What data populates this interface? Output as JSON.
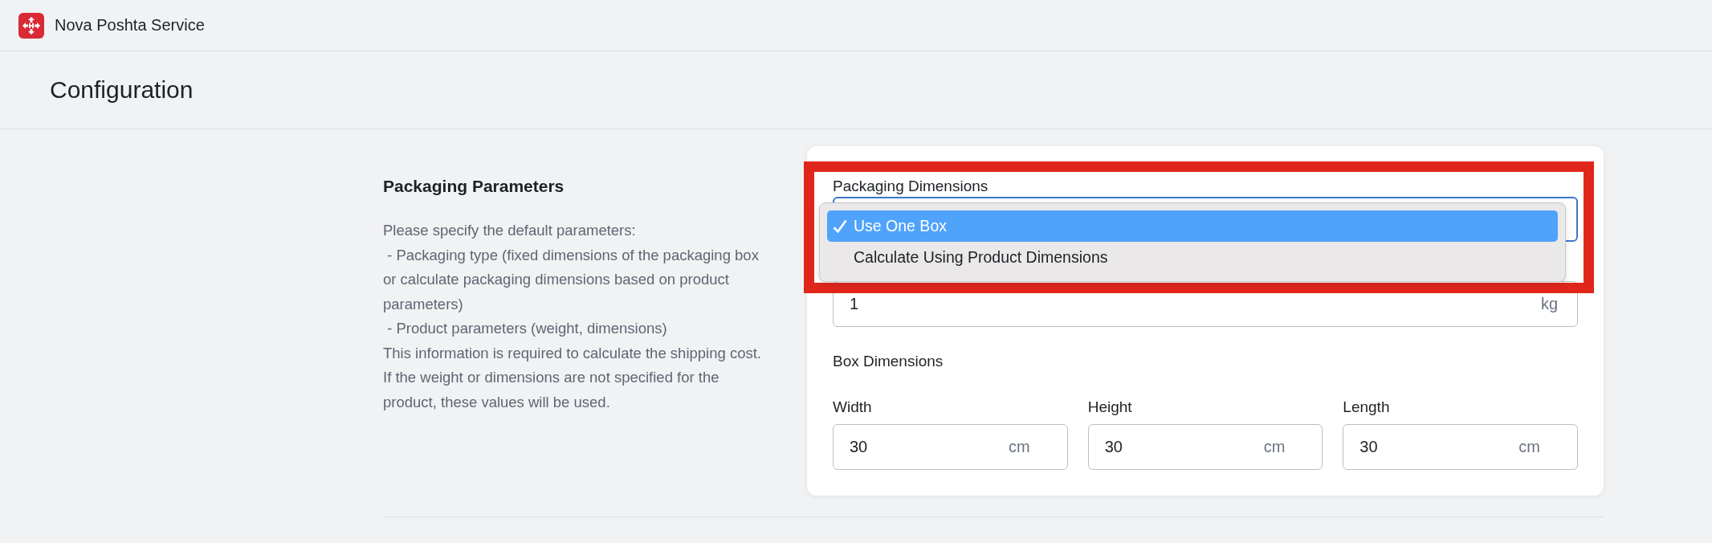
{
  "app": {
    "title": "Nova Poshta Service"
  },
  "page": {
    "title": "Configuration"
  },
  "section": {
    "title": "Packaging Parameters",
    "description": "Please specify the default parameters:\n - Packaging type (fixed dimensions of the packaging box or calculate packaging dimensions based on product parameters)\n - Product parameters (weight, dimensions)\nThis information is required to calculate the shipping cost. If the weight or dimensions are not specified for the product, these values will be used."
  },
  "form": {
    "packaging_dimensions": {
      "label": "Packaging Dimensions",
      "options": [
        {
          "label": "Use One Box",
          "selected": true
        },
        {
          "label": "Calculate Using Product Dimensions",
          "selected": false
        }
      ]
    },
    "weight": {
      "value": "1",
      "unit": "kg"
    },
    "box_dimensions": {
      "label": "Box Dimensions",
      "fields": [
        {
          "label": "Width",
          "value": "30",
          "unit": "cm"
        },
        {
          "label": "Height",
          "value": "30",
          "unit": "cm"
        },
        {
          "label": "Length",
          "value": "30",
          "unit": "cm"
        }
      ]
    }
  }
}
